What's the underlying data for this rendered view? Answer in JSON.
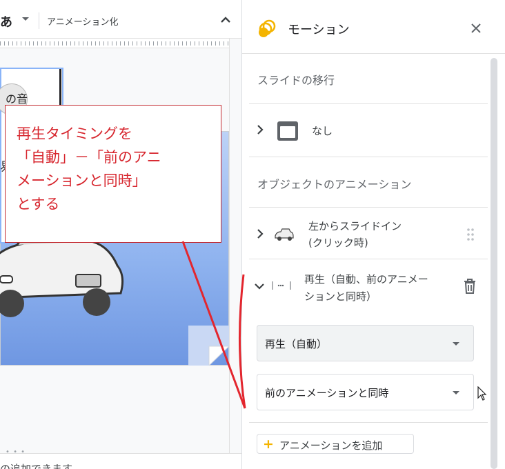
{
  "toolbar": {
    "font_label": "あ",
    "animate_label": "アニメーション化"
  },
  "slide": {
    "speaker_label": "の音",
    "cut_char": "易"
  },
  "callout": {
    "text": "再生タイミングを\n「自動」－「前のアニ\nメーションと同時」\nとする"
  },
  "notes": {
    "text": "の追加できます"
  },
  "panel": {
    "title": "モーション",
    "slide_transition_head": "スライドの移行",
    "transition_value": "なし",
    "object_anim_head": "オブジェクトのアニメーション",
    "animations": [
      {
        "line1": "左からスライドイン",
        "line2": "(クリック時)"
      },
      {
        "line1": "再生（自動、前のアニメー",
        "line2": "ションと同時）"
      }
    ],
    "start_select": "再生（自動）",
    "timing_select": "前のアニメーションと同時",
    "add_button": "アニメーションを追加"
  },
  "colors": {
    "callout_red": "#d7262e",
    "accent_yellow": "#f4b400"
  }
}
